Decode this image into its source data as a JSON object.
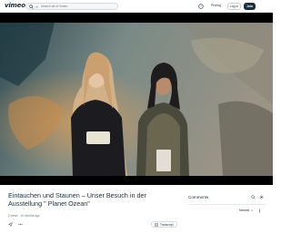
{
  "header": {
    "logo": "vimeo",
    "search_placeholder": "Search all of Vimeo",
    "pricing_label": "Pricing",
    "login_label": "Log in",
    "join_label": "Join"
  },
  "video": {
    "title": "Eintauchen und Staunen – Unser Besuch in der Ausstellung \" Planet Ozean\"",
    "meta": "2 views · 10 months ago",
    "transcript_label": "Transcript"
  },
  "comments": {
    "heading": "Comments",
    "sort_label": "Newest"
  },
  "icons": [
    "search-icon",
    "chevron-down-icon",
    "help-icon",
    "send-icon",
    "more-icon",
    "transcript-icon",
    "gear-icon"
  ]
}
